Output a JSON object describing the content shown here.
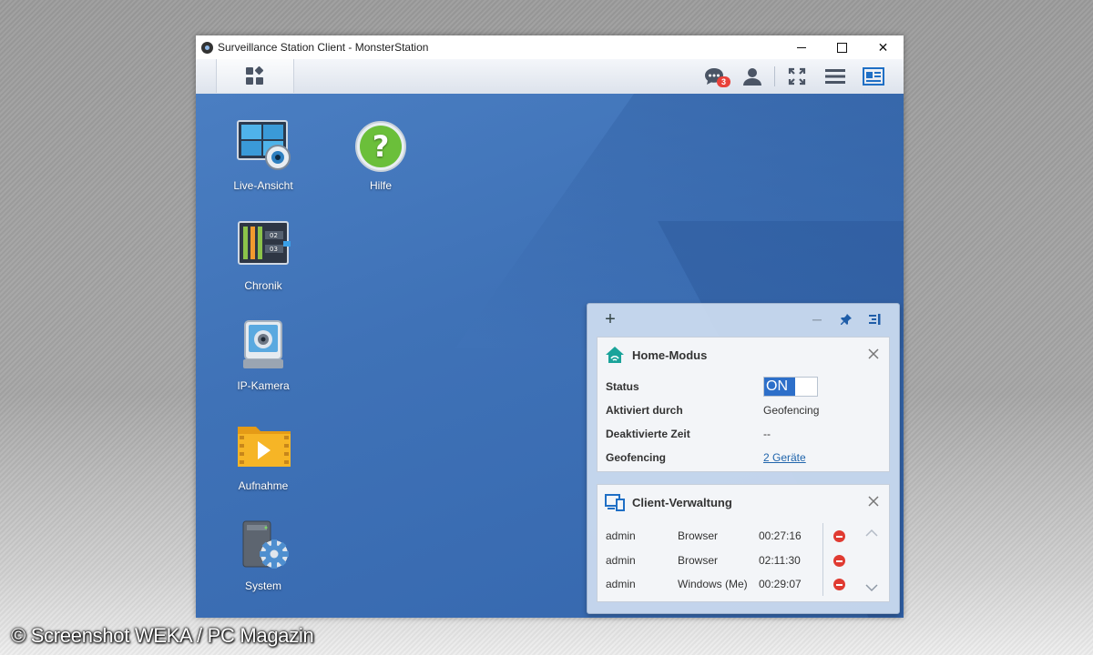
{
  "window": {
    "title": "Surveillance Station Client - MonsterStation",
    "controls": {
      "minimize": "─",
      "maximize": "□",
      "close": "✕"
    }
  },
  "toolbar": {
    "left_button_icon": "main-menu-grid-icon",
    "notification_count": "3",
    "icons": [
      "chat-notifications-icon",
      "user-icon",
      "fullscreen-icon",
      "list-menu-icon",
      "widget-panel-icon"
    ]
  },
  "desktop_icons": [
    {
      "label": "Live-Ansicht",
      "icon": "live-view-icon"
    },
    {
      "label": "Hilfe",
      "icon": "help-icon"
    },
    {
      "label": "Chronik",
      "icon": "timeline-icon"
    },
    {
      "label": "IP-Kamera",
      "icon": "ip-camera-icon"
    },
    {
      "label": "Aufnahme",
      "icon": "recording-folder-icon"
    },
    {
      "label": "System",
      "icon": "system-gear-icon"
    }
  ],
  "chronik_labels": [
    "02",
    "03"
  ],
  "panel": {
    "add_label": "+",
    "minimize_label": "─",
    "home_mode": {
      "title": "Home-Modus",
      "rows": [
        {
          "key": "Status",
          "value": "ON"
        },
        {
          "key": "Aktiviert durch",
          "value": "Geofencing"
        },
        {
          "key": "Deaktivierte Zeit",
          "value": "--"
        },
        {
          "key": "Geofencing",
          "value": "2 Geräte"
        }
      ]
    },
    "client_management": {
      "title": "Client-Verwaltung",
      "sessions": [
        {
          "user": "admin",
          "client": "Browser",
          "time": "00:27:16"
        },
        {
          "user": "admin",
          "client": "Browser",
          "time": "02:11:30"
        },
        {
          "user": "admin",
          "client": "Windows (Me)",
          "time": "00:29:07"
        }
      ]
    }
  },
  "watermark": "© Screenshot WEKA / PC Magazin",
  "colors": {
    "desktop": "#3f72b7",
    "accent": "#2d6fc9",
    "remove": "#e03b32",
    "home_icon": "#1aa39a"
  }
}
